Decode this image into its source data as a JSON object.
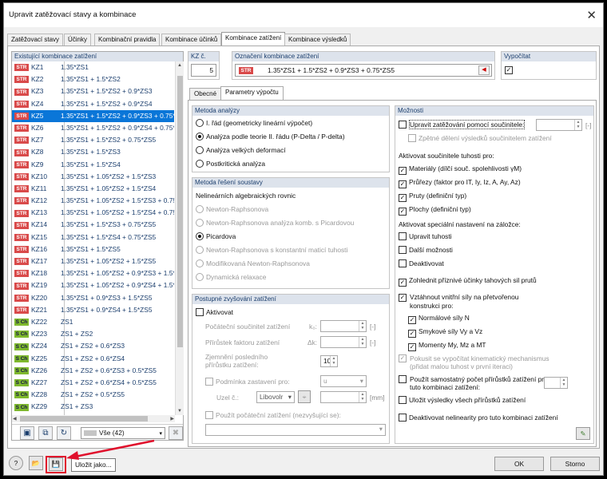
{
  "window": {
    "title": "Upravit zatěžovací stavy a kombinace",
    "close": "✕"
  },
  "tabs": [
    "Zatěžovací stavy",
    "Účinky",
    "Kombinační pravidla",
    "Kombinace účinků",
    "Kombinace zatížení",
    "Kombinace výsledků"
  ],
  "left": {
    "header": "Existující kombinace zatížení",
    "filter": "Vše (42)",
    "rows": [
      {
        "badge": "STR",
        "kz": "KZ1",
        "f": "1.35*ZS1"
      },
      {
        "badge": "STR",
        "kz": "KZ2",
        "f": "1.35*ZS1 + 1.5*ZS2"
      },
      {
        "badge": "STR",
        "kz": "KZ3",
        "f": "1.35*ZS1 + 1.5*ZS2 + 0.9*ZS3"
      },
      {
        "badge": "STR",
        "kz": "KZ4",
        "f": "1.35*ZS1 + 1.5*ZS2 + 0.9*ZS4"
      },
      {
        "badge": "STR",
        "kz": "KZ5",
        "f": "1.35*ZS1 + 1.5*ZS2 + 0.9*ZS3 + 0.75*ZS5"
      },
      {
        "badge": "STR",
        "kz": "KZ6",
        "f": "1.35*ZS1 + 1.5*ZS2 + 0.9*ZS4 + 0.75*ZS5"
      },
      {
        "badge": "STR",
        "kz": "KZ7",
        "f": "1.35*ZS1 + 1.5*ZS2 + 0.75*ZS5"
      },
      {
        "badge": "STR",
        "kz": "KZ8",
        "f": "1.35*ZS1 + 1.5*ZS3"
      },
      {
        "badge": "STR",
        "kz": "KZ9",
        "f": "1.35*ZS1 + 1.5*ZS4"
      },
      {
        "badge": "STR",
        "kz": "KZ10",
        "f": "1.35*ZS1 + 1.05*ZS2 + 1.5*ZS3"
      },
      {
        "badge": "STR",
        "kz": "KZ11",
        "f": "1.35*ZS1 + 1.05*ZS2 + 1.5*ZS4"
      },
      {
        "badge": "STR",
        "kz": "KZ12",
        "f": "1.35*ZS1 + 1.05*ZS2 + 1.5*ZS3 + 0.75*ZS5"
      },
      {
        "badge": "STR",
        "kz": "KZ13",
        "f": "1.35*ZS1 + 1.05*ZS2 + 1.5*ZS4 + 0.75*ZS5"
      },
      {
        "badge": "STR",
        "kz": "KZ14",
        "f": "1.35*ZS1 + 1.5*ZS3 + 0.75*ZS5"
      },
      {
        "badge": "STR",
        "kz": "KZ15",
        "f": "1.35*ZS1 + 1.5*ZS4 + 0.75*ZS5"
      },
      {
        "badge": "STR",
        "kz": "KZ16",
        "f": "1.35*ZS1 + 1.5*ZS5"
      },
      {
        "badge": "STR",
        "kz": "KZ17",
        "f": "1.35*ZS1 + 1.05*ZS2 + 1.5*ZS5"
      },
      {
        "badge": "STR",
        "kz": "KZ18",
        "f": "1.35*ZS1 + 1.05*ZS2 + 0.9*ZS3 + 1.5*ZS5"
      },
      {
        "badge": "STR",
        "kz": "KZ19",
        "f": "1.35*ZS1 + 1.05*ZS2 + 0.9*ZS4 + 1.5*ZS5"
      },
      {
        "badge": "STR",
        "kz": "KZ20",
        "f": "1.35*ZS1 + 0.9*ZS3 + 1.5*ZS5"
      },
      {
        "badge": "STR",
        "kz": "KZ21",
        "f": "1.35*ZS1 + 0.9*ZS4 + 1.5*ZS5"
      },
      {
        "badge": "S Ch",
        "kz": "KZ22",
        "f": "ZS1"
      },
      {
        "badge": "S Ch",
        "kz": "KZ23",
        "f": "ZS1 + ZS2"
      },
      {
        "badge": "S Ch",
        "kz": "KZ24",
        "f": "ZS1 + ZS2 + 0.6*ZS3"
      },
      {
        "badge": "S Ch",
        "kz": "KZ25",
        "f": "ZS1 + ZS2 + 0.6*ZS4"
      },
      {
        "badge": "S Ch",
        "kz": "KZ26",
        "f": "ZS1 + ZS2 + 0.6*ZS3 + 0.5*ZS5"
      },
      {
        "badge": "S Ch",
        "kz": "KZ27",
        "f": "ZS1 + ZS2 + 0.6*ZS4 + 0.5*ZS5"
      },
      {
        "badge": "S Ch",
        "kz": "KZ28",
        "f": "ZS1 + ZS2 + 0.5*ZS5"
      },
      {
        "badge": "S Ch",
        "kz": "KZ29",
        "f": "ZS1 + ZS3"
      },
      {
        "badge": "S Ch",
        "kz": "KZ30",
        "f": "ZS1 + ZS4"
      }
    ]
  },
  "kz": {
    "label": "KZ č.",
    "value": "5"
  },
  "desc": {
    "label": "Označení kombinace zatížení",
    "badge": "STR",
    "value": "1.35*ZS1 + 1.5*ZS2 + 0.9*ZS3 + 0.75*ZS5"
  },
  "calc": {
    "label": "Vypočítat"
  },
  "innertabs": [
    "Obecné",
    "Parametry výpočtu"
  ],
  "metoda": {
    "header": "Metoda analýzy",
    "opts": [
      "I. řád (geometricky lineární výpočet)",
      "Analýza podle teorie II. řádu (P-Delta / P-delta)",
      "Analýza velkých deformací",
      "Postkritická analýza"
    ]
  },
  "solver": {
    "header": "Metoda řešení soustavy",
    "sub": "Nelineárních algebraických rovnic",
    "opts": [
      "Newton-Raphsonova",
      "Newton-Raphsonova analýza komb. s Picardovou",
      "Picardova",
      "Newton-Raphsonova s konstantní maticí tuhosti",
      "Modifikovaná Newton-Raphsonova",
      "Dynamická relaxace"
    ]
  },
  "inc": {
    "header": "Postupné zvyšování zatížení",
    "active": "Aktivovat",
    "l1": "Počáteční součinitel zatížení",
    "s1": "k₀:",
    "l2": "Přírůstek faktoru zatížení",
    "s2": "Δk:",
    "l3": "Zjemnění posledního přírůstku zatížení:",
    "v3": "10",
    "u": "[-]",
    "stop": "Podmínka zastavení pro:",
    "stopval": "u",
    "node": "Uzel č.:",
    "nodeval": "Libovolr",
    "mm": "[mm]",
    "initial": "Použít počáteční zatížení (nezvyšující se):"
  },
  "opts": {
    "header": "Možnosti",
    "o1": "Upravit zatěžování pomocí součinitele:",
    "o1u": "[-]",
    "o1b": "Zpětné dělení výsledků součinitelem zatížení",
    "h2": "Aktivovat součinitele tuhosti pro:",
    "m1": "Materiály (dílčí souč. spolehlivosti γM)",
    "m2": "Průřezy (faktor pro IT, Iy, Iz, A, Ay, Az)",
    "m3": "Pruty (definiční typ)",
    "m4": "Plochy (definiční typ)",
    "h3": "Aktivovat speciální nastavení na záložce:",
    "s1": "Upravit tuhosti",
    "s2": "Další možnosti",
    "s3": "Deaktivovat",
    "fav": "Zohlednit příznivé účinky tahových sil prutů",
    "v1": "Vztáhnout vnitřní síly na přetvořenou konstrukci pro:",
    "n1": "Normálové síly N",
    "n2": "Smykové síly Vy a Vz",
    "n3": "Momenty My, Mz a MT",
    "kin": "Pokusit se vypočítat kinematický mechanismus (přidat malou tuhost v první iteraci)",
    "own": "Použít samostatný počet přírůstků zatížení pro tuto kombinaci zatížení:",
    "save": "Uložit výsledky všech přírůstků zatížení",
    "deact": "Deaktivovat nelinearity pro tuto kombinaci zatížení"
  },
  "bottom": {
    "tooltip": "Uložit jako...",
    "ok": "OK",
    "cancel": "Storno"
  }
}
